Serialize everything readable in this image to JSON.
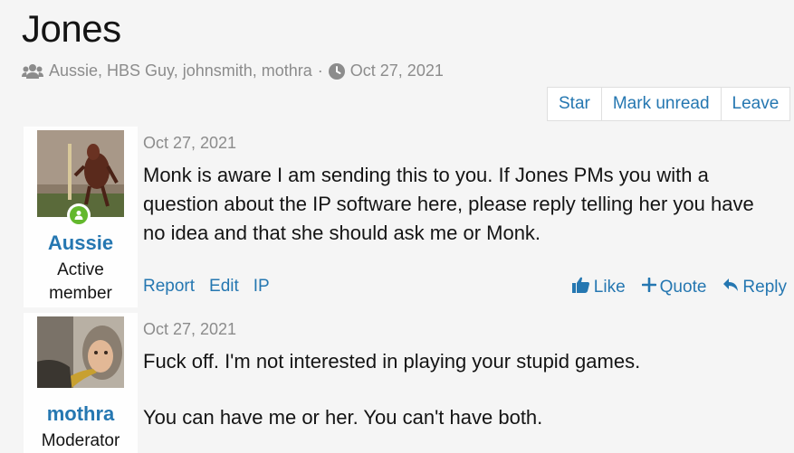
{
  "thread": {
    "title": "Jones",
    "participants": "Aussie, HBS Guy, johnsmith, mothra",
    "separator": "·",
    "date": "Oct 27, 2021"
  },
  "actions": [
    "Star",
    "Mark unread",
    "Leave"
  ],
  "messages": [
    {
      "username": "Aussie",
      "user_title": "Active member",
      "date": "Oct 27, 2021",
      "paragraphs": [
        "Monk is aware I am sending this to you. If Jones PMs you with a question about the IP software here, please reply telling her you have no idea and that she should ask me or Monk."
      ],
      "footer_left": [
        "Report",
        "Edit",
        "IP"
      ],
      "footer_right": {
        "like": "Like",
        "quote": "Quote",
        "reply": "Reply"
      }
    },
    {
      "username": "mothra",
      "user_title": "Moderator",
      "date": "Oct 27, 2021",
      "paragraphs": [
        "Fuck off. I'm not interested in playing your stupid games.",
        "You can have me or her. You can't have both."
      ]
    }
  ],
  "colors": {
    "link": "#2577b1",
    "muted": "#8c8c8c",
    "online": "#63b82d"
  }
}
